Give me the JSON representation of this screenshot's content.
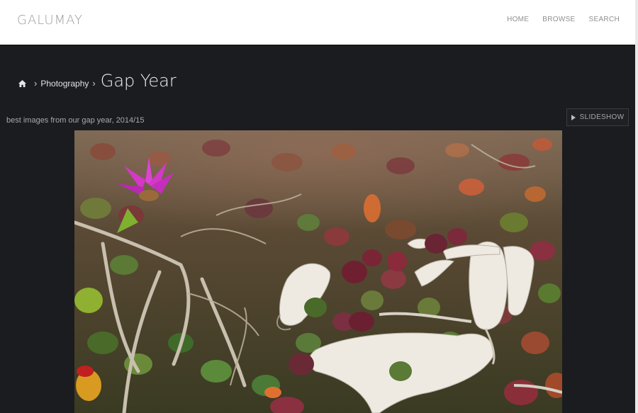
{
  "header": {
    "brand": "GALUMAY",
    "nav": [
      "HOME",
      "BROWSE",
      "SEARCH"
    ]
  },
  "breadcrumb": {
    "home_icon": "home-icon",
    "parent": "Photography",
    "title": "Gap Year"
  },
  "gallery": {
    "description": "best images from our gap year, 2014/15",
    "slideshow_label": "SLIDESHOW",
    "slideshow_icon": "play-icon"
  },
  "colors": {
    "page_background": "#1b1c1f",
    "header_background": "#ffffff"
  }
}
